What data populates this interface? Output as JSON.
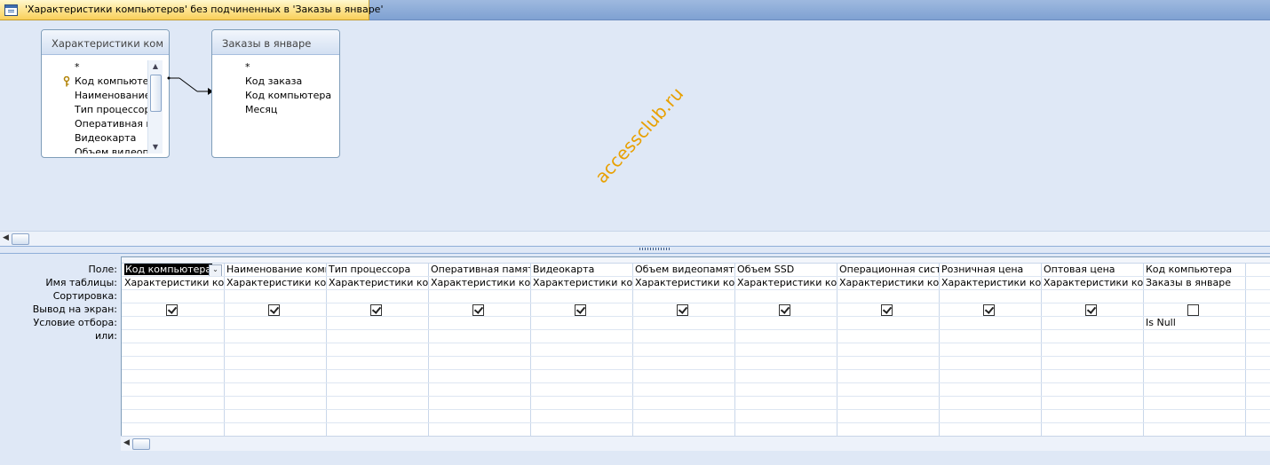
{
  "window": {
    "tab_title": "'Характеристики компьютеров' без подчиненных в 'Заказы в январе'"
  },
  "watermark": "accessclub.ru",
  "tables": [
    {
      "title": "Характеристики ком…",
      "fields": [
        "*",
        "Код компьютера",
        "Наименование",
        "Тип процессора",
        "Оперативная п",
        "Видеокарта",
        "Объем видеоп"
      ]
    },
    {
      "title": "Заказы в январе",
      "fields": [
        "*",
        "Код заказа",
        "Код компьютера",
        "Месяц"
      ]
    }
  ],
  "row_labels": [
    "Поле:",
    "Имя таблицы:",
    "Сортировка:",
    "Вывод на экран:",
    "Условие отбора:",
    "или:"
  ],
  "columns": [
    {
      "field": "Код компьютера",
      "table": "Характеристики ком",
      "show": true,
      "criteria": ""
    },
    {
      "field": "Наименование комп",
      "table": "Характеристики ком",
      "show": true,
      "criteria": ""
    },
    {
      "field": "Тип процессора",
      "table": "Характеристики ком",
      "show": true,
      "criteria": ""
    },
    {
      "field": "Оперативная памяти",
      "table": "Характеристики ком",
      "show": true,
      "criteria": ""
    },
    {
      "field": "Видеокарта",
      "table": "Характеристики ком",
      "show": true,
      "criteria": ""
    },
    {
      "field": "Объем видеопамяти",
      "table": "Характеристики ком",
      "show": true,
      "criteria": ""
    },
    {
      "field": "Объем SSD",
      "table": "Характеристики ком",
      "show": true,
      "criteria": ""
    },
    {
      "field": "Операционная систе",
      "table": "Характеристики ком",
      "show": true,
      "criteria": ""
    },
    {
      "field": "Розничная цена",
      "table": "Характеристики ком",
      "show": true,
      "criteria": ""
    },
    {
      "field": "Оптовая цена",
      "table": "Характеристики ком",
      "show": true,
      "criteria": ""
    },
    {
      "field": "Код компьютера",
      "table": "Заказы в январе",
      "show": false,
      "criteria": "Is Null"
    },
    {
      "field": "",
      "table": "",
      "show": null,
      "criteria": ""
    }
  ]
}
